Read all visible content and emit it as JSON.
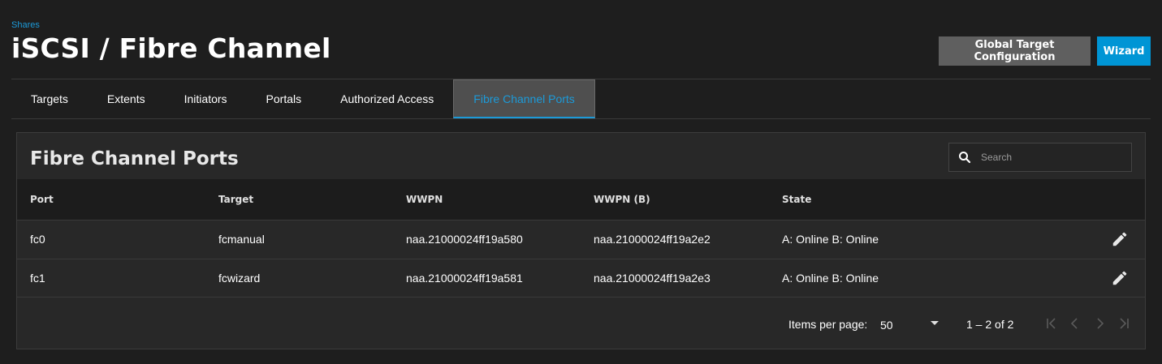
{
  "breadcrumb": "Shares",
  "page_title": "iSCSI / Fibre Channel",
  "header": {
    "global_target_config_label": "Global Target Configuration",
    "wizard_label": "Wizard"
  },
  "tabs": [
    {
      "label": "Targets"
    },
    {
      "label": "Extents"
    },
    {
      "label": "Initiators"
    },
    {
      "label": "Portals"
    },
    {
      "label": "Authorized Access"
    },
    {
      "label": "Fibre Channel Ports",
      "active": true
    }
  ],
  "card": {
    "title": "Fibre Channel Ports",
    "search_placeholder": "Search"
  },
  "table": {
    "columns": [
      "Port",
      "Target",
      "WWPN",
      "WWPN (B)",
      "State"
    ],
    "rows": [
      {
        "port": "fc0",
        "target": "fcmanual",
        "wwpn": "naa.21000024ff19a580",
        "wwpn_b": "naa.21000024ff19a2e2",
        "state": "A: Online B: Online"
      },
      {
        "port": "fc1",
        "target": "fcwizard",
        "wwpn": "naa.21000024ff19a581",
        "wwpn_b": "naa.21000024ff19a2e3",
        "state": "A: Online B: Online"
      }
    ]
  },
  "paginator": {
    "items_per_page_label": "Items per page:",
    "items_per_page_value": "50",
    "range_label": "1 – 2 of 2"
  },
  "colors": {
    "accent": "#1c9ad8",
    "primary_button": "#0095d5",
    "secondary_button": "#5f5f5f",
    "background": "#1e1e1e",
    "card": "#282828"
  },
  "icons": {
    "search": "search-icon",
    "edit": "pencil-icon",
    "dropdown": "caret-down-icon",
    "first_page": "first-page-icon",
    "prev_page": "chevron-left-icon",
    "next_page": "chevron-right-icon",
    "last_page": "last-page-icon"
  }
}
